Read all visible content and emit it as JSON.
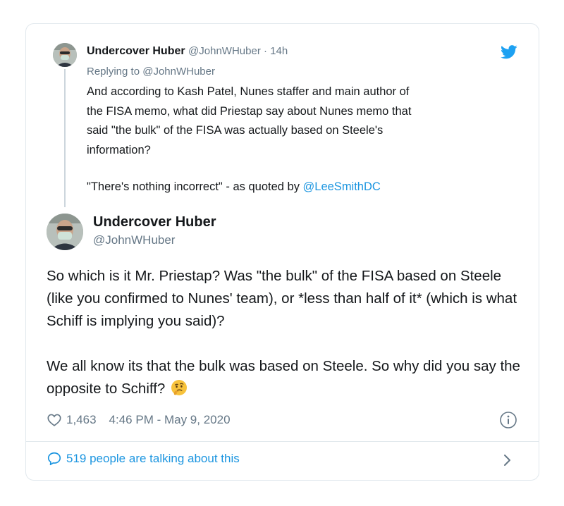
{
  "parent_tweet": {
    "display_name": "Undercover Huber",
    "handle": "@JohnWHuber",
    "separator": " · ",
    "time_ago": "14h",
    "replying_to_prefix": "Replying to ",
    "replying_to_handle": "@JohnWHuber",
    "text": "And according to Kash Patel, Nunes staffer and main author of\nthe FISA memo, what did Priestap say about Nunes memo that\nsaid \"the bulk\" of the FISA was actually based on Steele's\ninformation?",
    "quote_prefix": "\"There's nothing incorrect\" - as quoted by ",
    "quote_mention": "@LeeSmithDC"
  },
  "main_tweet": {
    "display_name": "Undercover Huber",
    "handle": "@JohnWHuber",
    "paragraph_1": "So which is it Mr. Priestap? Was \"the bulk\" of the FISA based on Steele (like you confirmed to Nunes' team), or *less than half of it* (which is what Schiff is implying you said)?",
    "paragraph_2": "We all know its that the bulk was based on Steele. So why did you say the opposite to Schiff?",
    "like_count": "1,463",
    "timestamp": "4:46 PM - May 9, 2020",
    "talking_text": "519 people are talking about this"
  },
  "icons": {
    "brand": "twitter-bird-icon",
    "like": "heart-icon",
    "info": "info-icon",
    "conversation": "speech-bubble-icon",
    "chevron": "chevron-right-icon",
    "emoji": "thinking-face-emoji"
  },
  "colors": {
    "link": "#1b95e0",
    "muted": "#657786",
    "text": "#14171a",
    "border": "#e1e8ed",
    "thread_line": "#ccd6dd"
  }
}
